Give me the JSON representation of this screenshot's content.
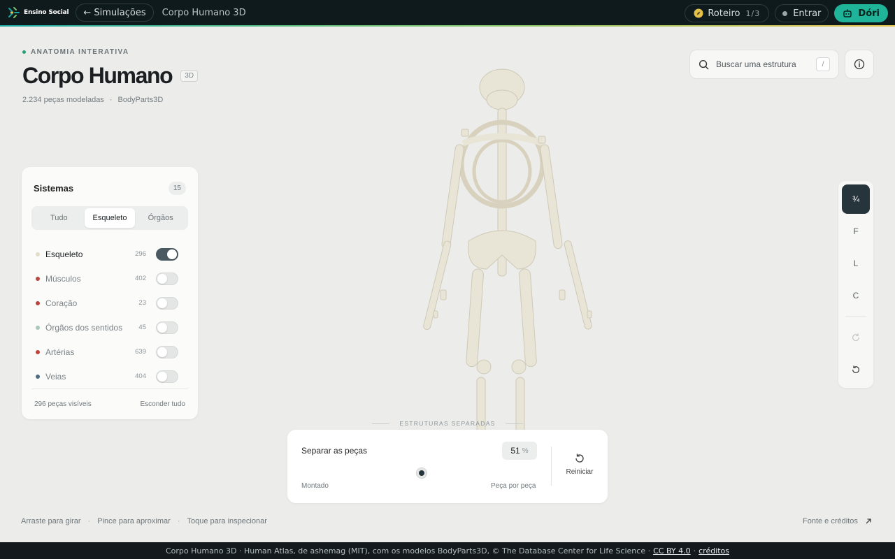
{
  "topbar": {
    "brand": "Ensino Social",
    "back_label": "← Simulações",
    "crumb": "Corpo Humano 3D",
    "roteiro_label": "Roteiro",
    "roteiro_count": "1/3",
    "entrar_label": "Entrar",
    "dori_label": "Dóri"
  },
  "header": {
    "eyebrow": "ANATOMIA INTERATIVA",
    "title": "Corpo Humano",
    "tag": "3D",
    "pieces": "2.234 peças modeladas",
    "sep": "·",
    "source": "BodyParts3D"
  },
  "search": {
    "placeholder": "Buscar uma estrutura",
    "shortcut": "/"
  },
  "systems": {
    "title": "Sistemas",
    "count": "15",
    "tabs": [
      {
        "label": "Tudo",
        "active": false
      },
      {
        "label": "Esqueleto",
        "active": true
      },
      {
        "label": "Órgãos",
        "active": false
      }
    ],
    "items": [
      {
        "label": "Esqueleto",
        "count": "296",
        "on": true,
        "color": "#e3dcc8"
      },
      {
        "label": "Músculos",
        "count": "402",
        "on": false,
        "color": "#b84a44"
      },
      {
        "label": "Coração",
        "count": "23",
        "on": false,
        "color": "#b8463f"
      },
      {
        "label": "Órgãos dos sentidos",
        "count": "45",
        "on": false,
        "color": "#a9c7bf"
      },
      {
        "label": "Artérias",
        "count": "639",
        "on": false,
        "color": "#c0443b"
      },
      {
        "label": "Veias",
        "count": "404",
        "on": false,
        "color": "#4e6b82"
      }
    ],
    "visible": "296 peças visíveis",
    "hide_all": "Esconder tudo"
  },
  "rail": {
    "views": [
      {
        "label": "¾",
        "active": true
      },
      {
        "label": "F",
        "active": false
      },
      {
        "label": "L",
        "active": false
      },
      {
        "label": "C",
        "active": false
      }
    ]
  },
  "separation": {
    "caption": "ESTRUTURAS SEPARADAS",
    "label": "Separar as peças",
    "value": "51",
    "unit": "%",
    "level": 0.51,
    "min_label": "Montado",
    "max_label": "Peça por peça",
    "reset_label": "Reiniciar"
  },
  "hints": {
    "rotate": "Arraste para girar",
    "zoom": "Pince para aproximar",
    "inspect": "Toque para inspecionar",
    "sep": "·"
  },
  "credits_link": "Fonte e créditos",
  "footer": {
    "text": "Corpo Humano 3D · Human Atlas, de ashemag (MIT), com os modelos BodyParts3D, © The Database Center for Life Science ·",
    "license": "CC BY 4.0",
    "dot": "·",
    "credits": "créditos"
  },
  "colors": {
    "accent": "#1fb39a",
    "dark": "#26343c",
    "bone": "#e8e4d6"
  }
}
